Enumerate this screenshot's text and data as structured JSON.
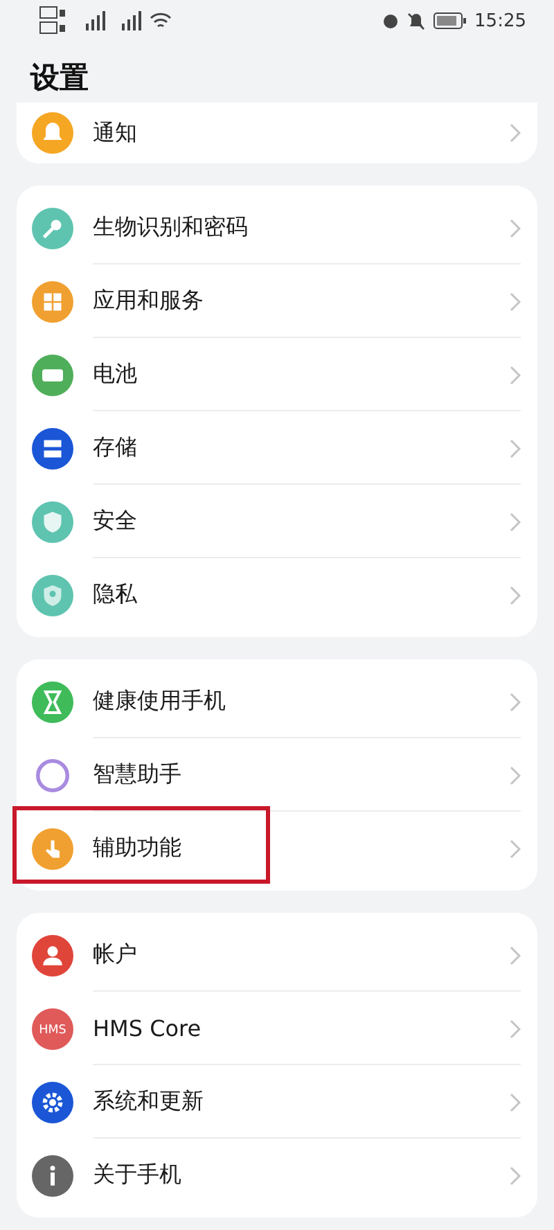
{
  "status_bar": {
    "time": "15:25"
  },
  "title": "设置",
  "groups": [
    {
      "partial": true,
      "items": [
        {
          "label": "通知",
          "kind": "bell",
          "color": "#f5a623",
          "highlighted": false
        }
      ]
    },
    {
      "partial": false,
      "items": [
        {
          "label": "生物识别和密码",
          "kind": "key",
          "color": "#5ec4b0",
          "highlighted": false
        },
        {
          "label": "应用和服务",
          "kind": "grid",
          "color": "#f0a030",
          "highlighted": false
        },
        {
          "label": "电池",
          "kind": "battery",
          "color": "#4fae5a",
          "highlighted": false
        },
        {
          "label": "存储",
          "kind": "storage",
          "color": "#1a56d6",
          "highlighted": false
        },
        {
          "label": "安全",
          "kind": "shield",
          "color": "#5ec4b0",
          "highlighted": false
        },
        {
          "label": "隐私",
          "kind": "privacy",
          "color": "#5ec4b0",
          "highlighted": false
        }
      ]
    },
    {
      "partial": false,
      "items": [
        {
          "label": "健康使用手机",
          "kind": "hourglass",
          "color": "#3fbb5a",
          "highlighted": false
        },
        {
          "label": "智慧助手",
          "kind": "ring",
          "color": "#a98be0",
          "highlighted": false
        },
        {
          "label": "辅助功能",
          "kind": "hand",
          "color": "#f0a030",
          "highlighted": true
        }
      ]
    },
    {
      "partial": false,
      "items": [
        {
          "label": "帐户",
          "kind": "person",
          "color": "#e0453a",
          "highlighted": false
        },
        {
          "label": "HMS Core",
          "kind": "text",
          "icon_text": "HMS",
          "color": "#e05a5a",
          "highlighted": false
        },
        {
          "label": "系统和更新",
          "kind": "gear",
          "color": "#1a56d6",
          "highlighted": false
        },
        {
          "label": "关于手机",
          "kind": "info",
          "color": "#666666",
          "highlighted": false
        }
      ]
    }
  ]
}
